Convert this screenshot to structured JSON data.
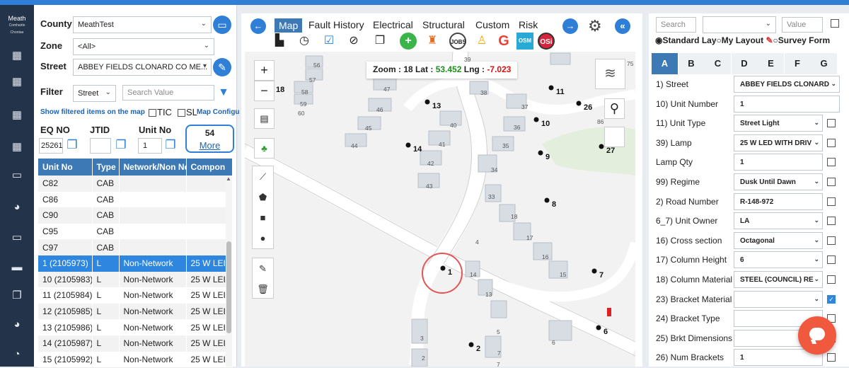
{
  "sidebar": {
    "logo_text": "Meath",
    "logo_sub": "Comhairle Chontae",
    "icons": [
      "grid-icon",
      "grid-icon",
      "grid-icon",
      "grid-icon",
      "monitor-icon",
      "palette-icon",
      "monitor-icon",
      "truck-icon",
      "copy-icon",
      "palette-icon",
      "pie-chart-icon"
    ]
  },
  "left": {
    "county_label": "County",
    "county_value": "MeathTest",
    "zone_label": "Zone",
    "zone_value": "<All>",
    "street_label": "Street",
    "street_value": "ABBEY FIELDS CLONARD CO ME...",
    "filter_label": "Filter",
    "filter_value": "Street",
    "search_placeholder": "Search Value",
    "show_filtered": "Show filtered items on the map",
    "tic_label": "TIC",
    "sl_label": "SL",
    "map_config": "Map Configu",
    "eq_label": "EQ NO",
    "eq_value": "25261",
    "jtid_label": "JTID",
    "jtid_value": "",
    "unit_label": "Unit No",
    "unit_value": "1",
    "more_count": "54",
    "more_label": "More",
    "table": {
      "headers": [
        "Unit No",
        "Type",
        "Network/Non Ne",
        "Compon"
      ],
      "rows": [
        [
          "C82",
          "CAB",
          "",
          ""
        ],
        [
          "C86",
          "CAB",
          "",
          ""
        ],
        [
          "C90",
          "CAB",
          "",
          ""
        ],
        [
          "C95",
          "CAB",
          "",
          ""
        ],
        [
          "C97",
          "CAB",
          "",
          ""
        ],
        [
          "1 (2105973)",
          "L",
          "Non-Network",
          "25 W LEI"
        ],
        [
          "10 (2105983)",
          "L",
          "Non-Network",
          "25 W LEI"
        ],
        [
          "11 (2105984)",
          "L",
          "Non-Network",
          "25 W LEI"
        ],
        [
          "12 (2105985)",
          "L",
          "Non-Network",
          "25 W LEI"
        ],
        [
          "13 (2105986)",
          "L",
          "Non-Network",
          "25 W LEI"
        ],
        [
          "14 (2105987)",
          "L",
          "Non-Network",
          "25 W LEI"
        ],
        [
          "15 (2105992)",
          "L",
          "Non-Network",
          "25 W LEI"
        ]
      ],
      "selected_row": 5
    }
  },
  "map": {
    "tabs": [
      "Map",
      "Fault History",
      "Electrical",
      "Structural",
      "Custom",
      "Risk"
    ],
    "active_tab": "Map",
    "zoom_text": "Zoom : 18 Lat :",
    "lat": "53.452",
    "lng_label": "Lng :",
    "lng": "-7.023",
    "plus": "+",
    "minus": "−",
    "markers": [
      {
        "label": "18"
      },
      {
        "label": "11"
      },
      {
        "label": "13"
      },
      {
        "label": "26"
      },
      {
        "label": "10"
      },
      {
        "label": "14"
      },
      {
        "label": "9"
      },
      {
        "label": "27"
      },
      {
        "label": "8"
      },
      {
        "label": "1"
      },
      {
        "label": "7"
      },
      {
        "label": "6"
      },
      {
        "label": "2"
      }
    ],
    "house_numbers": [
      "56",
      "57",
      "58",
      "59",
      "60",
      "47",
      "46",
      "45",
      "44",
      "42",
      "41",
      "40",
      "43",
      "39",
      "38",
      "37",
      "36",
      "35",
      "34",
      "33",
      "18",
      "17",
      "16",
      "15",
      "14",
      "13",
      "4",
      "5",
      "6",
      "7",
      "7",
      "3",
      "2",
      "86"
    ],
    "edge_labels": [
      "75"
    ]
  },
  "right": {
    "search_label": "Search",
    "value_placeholder": "Value",
    "standard_layout": "Standard Lay",
    "my_layout": "My Layout",
    "survey_form": "Survey Form",
    "tabs": [
      "A",
      "B",
      "C",
      "D",
      "E",
      "F",
      "G"
    ],
    "active_tab": "A",
    "fields": [
      {
        "label": "1) Street",
        "value": "ABBEY FIELDS CLONARD",
        "dropdown": true,
        "checked": null,
        "wide": true
      },
      {
        "label": "10) Unit Number",
        "value": "1",
        "dropdown": false,
        "checked": null,
        "wide": true
      },
      {
        "label": "11) Unit Type",
        "value": "Street Light",
        "dropdown": true,
        "checked": false
      },
      {
        "label": "39) Lamp",
        "value": "25 W LED WITH DRIV",
        "dropdown": true,
        "checked": false
      },
      {
        "label": "Lamp Qty",
        "value": "1",
        "dropdown": false,
        "checked": false
      },
      {
        "label": "99) Regime",
        "value": "Dusk Until Dawn",
        "dropdown": true,
        "checked": false
      },
      {
        "label": "2) Road Number",
        "value": "R-148-972",
        "dropdown": false,
        "checked": false
      },
      {
        "label": "6_7) Unit Owner",
        "value": "LA",
        "dropdown": true,
        "checked": false
      },
      {
        "label": "16) Cross section",
        "value": "Octagonal",
        "dropdown": true,
        "checked": false
      },
      {
        "label": "17) Column Height",
        "value": "6",
        "dropdown": true,
        "checked": false
      },
      {
        "label": "18) Column Material",
        "value": "STEEL (COUNCIL) RE",
        "dropdown": true,
        "checked": false
      },
      {
        "label": "23) Bracket Material",
        "value": "",
        "dropdown": true,
        "checked": true
      },
      {
        "label": "24) Bracket Type",
        "value": "",
        "dropdown": false,
        "checked": false
      },
      {
        "label": "25) Brkt Dimensions",
        "value": "",
        "dropdown": false,
        "checked": false
      },
      {
        "label": "26) Num Brackets",
        "value": "1",
        "dropdown": false,
        "checked": false
      }
    ]
  }
}
